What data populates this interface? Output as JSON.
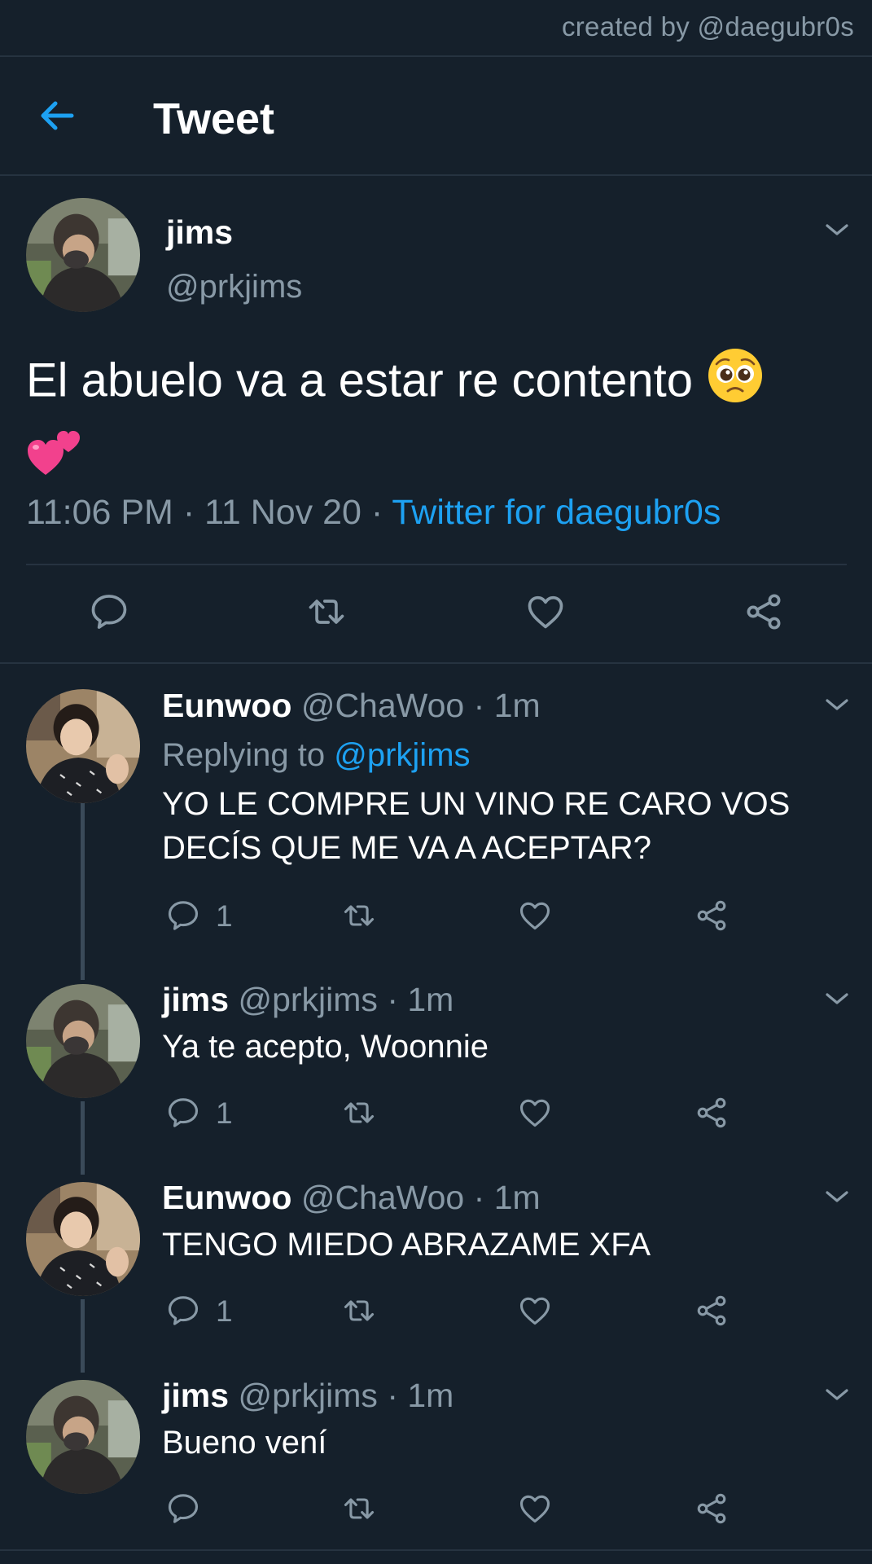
{
  "watermark": "created by @daegubr0s",
  "header": {
    "title": "Tweet"
  },
  "main_tweet": {
    "name": "jims",
    "handle": "@prkjims",
    "text": "El abuelo va a estar re contento",
    "time": "11:06 PM",
    "date": "11 Nov 20",
    "source": "Twitter for daegubr0s",
    "sep": "·"
  },
  "replies": [
    {
      "name": "Eunwoo",
      "handle": "@ChaWoo",
      "time": "1m",
      "sep": "·",
      "replying_label": "Replying to",
      "replying_to": "@prkjims",
      "text": "YO LE COMPRE UN VINO RE CARO VOS DECÍS QUE ME VA A ACEPTAR?",
      "reply_count": "1"
    },
    {
      "name": "jims",
      "handle": "@prkjims",
      "time": "1m",
      "sep": "·",
      "text": "Ya te acepto, Woonnie",
      "reply_count": "1"
    },
    {
      "name": "Eunwoo",
      "handle": "@ChaWoo",
      "time": "1m",
      "sep": "·",
      "text": "TENGO MIEDO ABRAZAME XFA",
      "reply_count": "1"
    },
    {
      "name": "jims",
      "handle": "@prkjims",
      "time": "1m",
      "sep": "·",
      "text": "Bueno vení"
    }
  ],
  "colors": {
    "background": "#15202b",
    "accent": "#1da1f2",
    "secondary_text": "#8899a6",
    "divider": "#263340"
  },
  "icons": [
    "back-arrow-icon",
    "chevron-down-icon",
    "reply-icon",
    "retweet-icon",
    "like-icon",
    "share-icon",
    "pleading-face-emoji",
    "two-hearts-emoji"
  ]
}
